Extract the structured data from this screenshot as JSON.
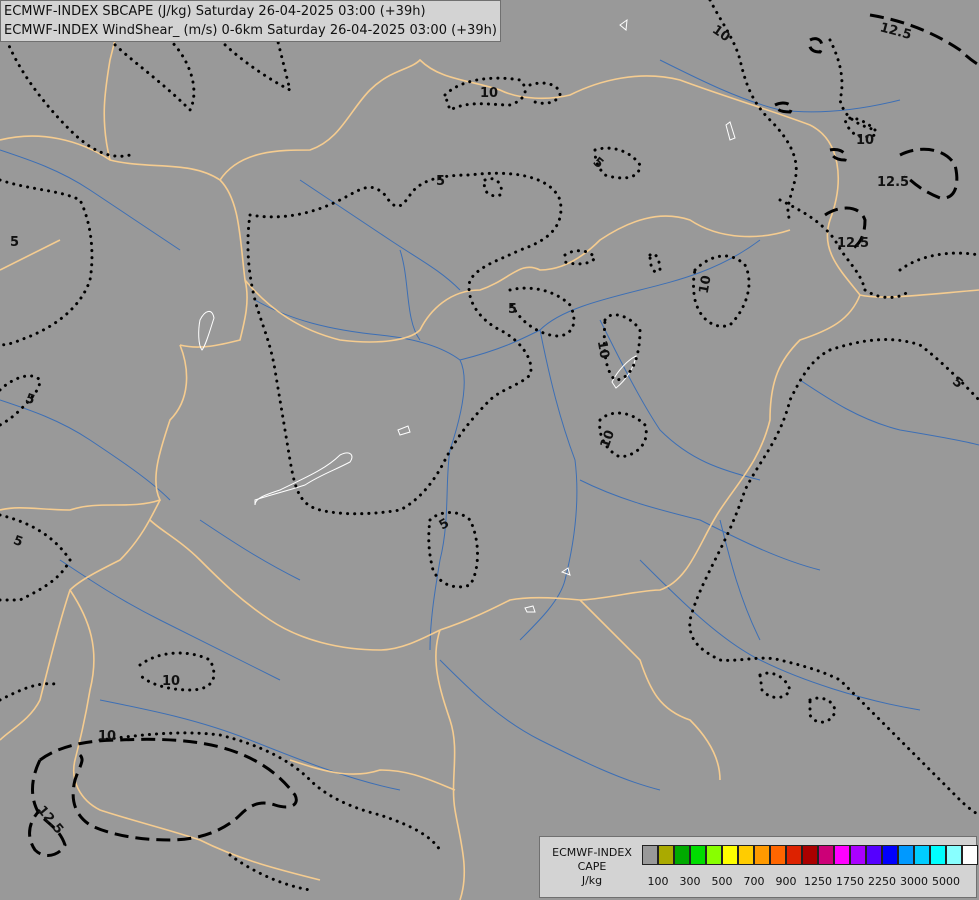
{
  "title_lines": [
    "ECMWF-INDEX SBCAPE (J/kg) Saturday 26-04-2025 03:00 (+39h)",
    "ECMWF-INDEX WindShear_ (m/s) 0-6km Saturday 26-04-2025 03:00 (+39h)"
  ],
  "contour_labels": [
    "10",
    "12.5",
    "5",
    "10",
    "12.5",
    "12.5",
    "5",
    "10",
    "5",
    "10",
    "5",
    "10",
    "5",
    "5",
    "5",
    "10",
    "10",
    "12.5",
    "5"
  ],
  "legend": {
    "line1": "ECMWF-INDEX",
    "line2": "CAPE",
    "line3": "J/kg",
    "colors": [
      "#999999",
      "#aaaa00",
      "#00aa00",
      "#00dd00",
      "#88ff00",
      "#ffff00",
      "#ffcc00",
      "#ff9900",
      "#ff6600",
      "#dd2200",
      "#aa0000",
      "#cc0077",
      "#ff00ff",
      "#aa00ff",
      "#5500ff",
      "#0000ff",
      "#0099ff",
      "#00ccff",
      "#00ffff",
      "#88ffff",
      "#ffffff"
    ],
    "tick_labels": [
      "100",
      "300",
      "500",
      "700",
      "900",
      "1250",
      "1750",
      "2250",
      "3000",
      "5000"
    ]
  }
}
